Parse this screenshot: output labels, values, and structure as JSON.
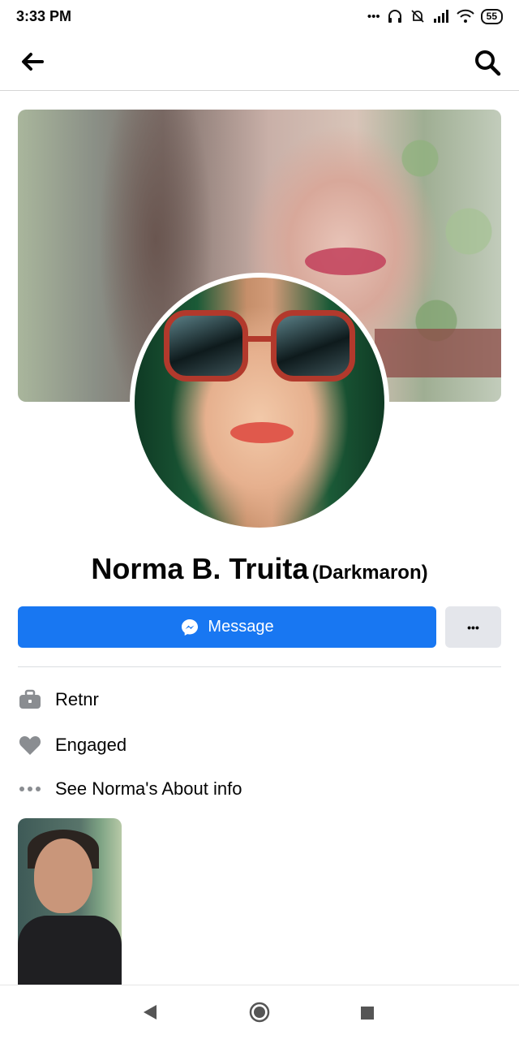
{
  "status_bar": {
    "time": "3:33 PM",
    "battery": "55"
  },
  "profile": {
    "name": "Norma B. Truita",
    "alternate_name": "(Darkmaron)"
  },
  "actions": {
    "message_label": "Message",
    "more_label": "•••"
  },
  "about": {
    "items": [
      {
        "icon": "briefcase-icon",
        "label": "Retnr"
      },
      {
        "icon": "heart-icon",
        "label": "Engaged"
      },
      {
        "icon": "more-dots-icon",
        "label": "See Norma's About info"
      }
    ]
  },
  "colors": {
    "accent": "#1877f2",
    "secondary_button": "#e4e6eb",
    "icon_gray": "#8a8d91"
  }
}
